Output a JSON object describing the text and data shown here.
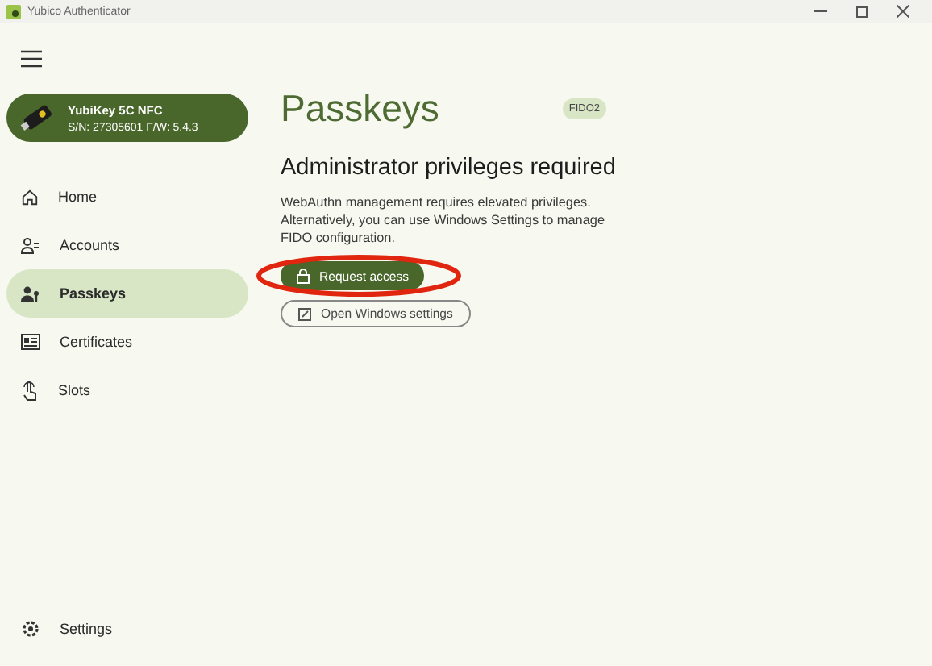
{
  "window": {
    "title": "Yubico Authenticator"
  },
  "device": {
    "name": "YubiKey 5C NFC",
    "info": "S/N: 27305601 F/W: 5.4.3"
  },
  "sidebar": {
    "items": [
      {
        "label": "Home",
        "selected": false
      },
      {
        "label": "Accounts",
        "selected": false
      },
      {
        "label": "Passkeys",
        "selected": true
      },
      {
        "label": "Certificates",
        "selected": false
      },
      {
        "label": "Slots",
        "selected": false
      }
    ],
    "footer": {
      "label": "Settings"
    }
  },
  "main": {
    "title": "Passkeys",
    "badge": "FIDO2",
    "heading": "Administrator privileges required",
    "message": "WebAuthn management requires elevated privileges. Alternatively, you can use Windows Settings to manage FIDO configuration.",
    "buttons": [
      {
        "label": "Request access",
        "kind": "primary",
        "highlighted": true
      },
      {
        "label": "Open Windows settings",
        "kind": "outlined",
        "highlighted": false
      }
    ]
  }
}
